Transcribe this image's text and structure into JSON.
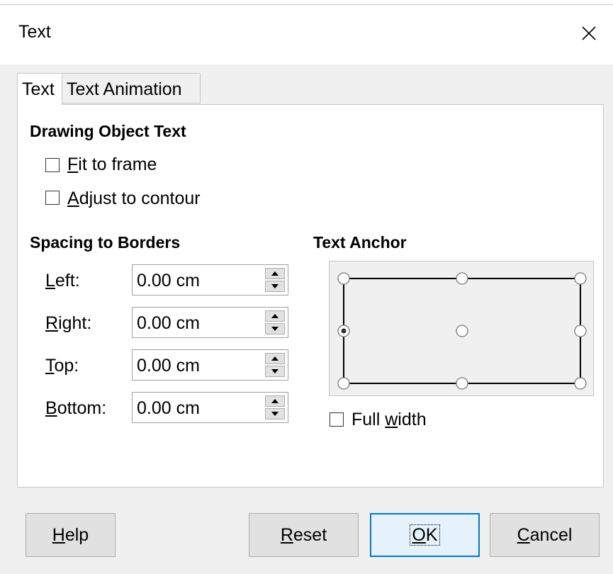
{
  "dialog": {
    "title": "Text"
  },
  "tabs": [
    {
      "label": "Text",
      "active": true
    },
    {
      "label": "Text Animation",
      "active": false
    }
  ],
  "drawing_object_text": {
    "heading": "Drawing Object Text",
    "fit_to_frame": {
      "label_mnemonic": "F",
      "label_rest": "it to frame",
      "checked": false
    },
    "adjust_to_contour": {
      "label_mnemonic": "A",
      "label_rest": "djust to contour",
      "checked": false
    }
  },
  "spacing": {
    "heading": "Spacing to Borders",
    "left": {
      "label_mnemonic": "L",
      "label_rest": "eft:",
      "value": "0.00 cm"
    },
    "right": {
      "label_mnemonic": "R",
      "label_rest": "ight:",
      "value": "0.00 cm"
    },
    "top": {
      "label_mnemonic": "T",
      "label_rest": "op:",
      "value": "0.00 cm"
    },
    "bottom": {
      "label_mnemonic": "B",
      "label_rest": "ottom:",
      "value": "0.00 cm"
    }
  },
  "text_anchor": {
    "heading": "Text Anchor",
    "selected": "middle-left",
    "full_width": {
      "label_pre": "Full ",
      "label_mnemonic": "w",
      "label_rest": "idth",
      "checked": false
    }
  },
  "buttons": {
    "help": {
      "mnemonic": "H",
      "rest": "elp"
    },
    "reset": {
      "mnemonic": "R",
      "rest": "eset"
    },
    "ok": {
      "mnemonic": "O",
      "rest": "K"
    },
    "cancel": {
      "mnemonic": "C",
      "rest": "ancel"
    }
  },
  "colors": {
    "accent": "#0078d7",
    "background": "#f0f0f0",
    "panel": "#ffffff"
  }
}
